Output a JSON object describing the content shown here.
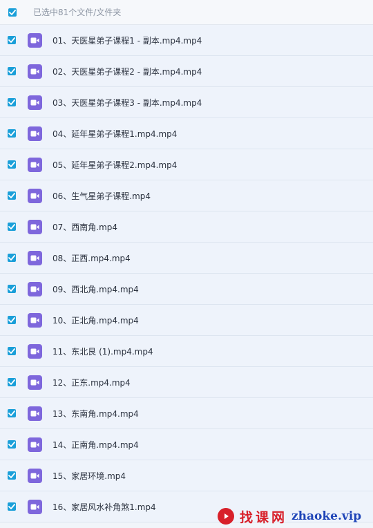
{
  "header": {
    "selection_label": "已选中81个文件/文件夹"
  },
  "files": [
    {
      "name": "01、天医星弟子课程1 - 副本.mp4.mp4",
      "icon": "video-file-icon"
    },
    {
      "name": "02、天医星弟子课程2 - 副本.mp4.mp4",
      "icon": "video-file-icon"
    },
    {
      "name": "03、天医星弟子课程3 - 副本.mp4.mp4",
      "icon": "video-file-icon"
    },
    {
      "name": "04、延年星弟子课程1.mp4.mp4",
      "icon": "video-file-icon"
    },
    {
      "name": "05、延年星弟子课程2.mp4.mp4",
      "icon": "video-file-icon"
    },
    {
      "name": "06、生气星弟子课程.mp4",
      "icon": "video-file-icon"
    },
    {
      "name": "07、西南角.mp4",
      "icon": "video-file-icon"
    },
    {
      "name": "08、正西.mp4.mp4",
      "icon": "video-file-icon"
    },
    {
      "name": "09、西北角.mp4.mp4",
      "icon": "video-file-icon"
    },
    {
      "name": "10、正北角.mp4.mp4",
      "icon": "video-file-icon"
    },
    {
      "name": "11、东北艮 (1).mp4.mp4",
      "icon": "video-file-icon"
    },
    {
      "name": "12、正东.mp4.mp4",
      "icon": "video-file-icon"
    },
    {
      "name": "13、东南角.mp4.mp4",
      "icon": "video-file-icon"
    },
    {
      "name": "14、正南角.mp4.mp4",
      "icon": "video-file-icon"
    },
    {
      "name": "15、家居环境.mp4",
      "icon": "video-file-icon"
    },
    {
      "name": "16、家居风水补角煞1.mp4",
      "icon": "video-file-icon"
    }
  ],
  "watermark": {
    "brand_cn": "找课网",
    "brand_domain": "zhaoke.vip",
    "icon": "play-logo-icon"
  },
  "colors": {
    "checkbox": "#1a9fd9",
    "video_icon": "#7e67dc",
    "row_background": "#eef3fb",
    "watermark_red": "#d8202a",
    "watermark_blue": "#1f45b8"
  }
}
